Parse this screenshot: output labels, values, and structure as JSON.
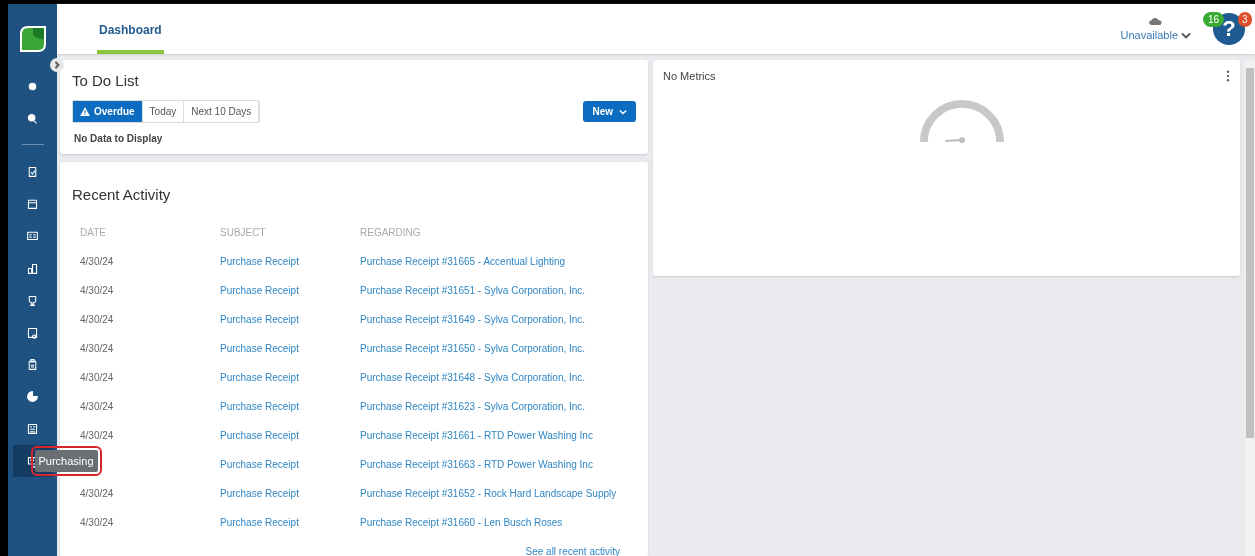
{
  "header": {
    "tabs": [
      {
        "label": "Dashboard",
        "selected": true
      }
    ],
    "status": {
      "label": "Unavailable"
    },
    "help": {
      "label": "?",
      "badges": [
        {
          "count": "16",
          "color": "#3aaa35"
        },
        {
          "count": "3",
          "color": "#e04e2b"
        }
      ]
    }
  },
  "sidebar": {
    "items": [
      {
        "hovered": false
      },
      {
        "hovered": false
      },
      {
        "hovered": false
      },
      {
        "hovered": false
      },
      {
        "hovered": false
      },
      {
        "hovered": false
      },
      {
        "hovered": false
      },
      {
        "hovered": false
      },
      {
        "hovered": false
      },
      {
        "hovered": false
      },
      {
        "hovered": false
      },
      {
        "hovered": true
      }
    ],
    "tooltip": "Purchasing"
  },
  "todo": {
    "title": "To Do List",
    "filters": [
      {
        "label": "Overdue",
        "selected": true
      },
      {
        "label": "Today",
        "selected": false
      },
      {
        "label": "Next 10 Days",
        "selected": false
      }
    ],
    "new_button": "New",
    "empty": "No Data to Display"
  },
  "recent": {
    "title": "Recent Activity",
    "columns": [
      "DATE",
      "SUBJECT",
      "REGARDING"
    ],
    "rows": [
      {
        "date": "4/30/24",
        "subject": "Purchase Receipt",
        "regarding": "Purchase Receipt #31665 - Accentual Lighting"
      },
      {
        "date": "4/30/24",
        "subject": "Purchase Receipt",
        "regarding": "Purchase Receipt #31651 - Sylva Corporation, Inc."
      },
      {
        "date": "4/30/24",
        "subject": "Purchase Receipt",
        "regarding": "Purchase Receipt #31649 - Sylva Corporation, Inc."
      },
      {
        "date": "4/30/24",
        "subject": "Purchase Receipt",
        "regarding": "Purchase Receipt #31650 - Sylva Corporation, Inc."
      },
      {
        "date": "4/30/24",
        "subject": "Purchase Receipt",
        "regarding": "Purchase Receipt #31648 - Sylva Corporation, Inc."
      },
      {
        "date": "4/30/24",
        "subject": "Purchase Receipt",
        "regarding": "Purchase Receipt #31623 - Sylva Corporation, Inc."
      },
      {
        "date": "4/30/24",
        "subject": "Purchase Receipt",
        "regarding": "Purchase Receipt #31661 - RTD Power Washing Inc"
      },
      {
        "subject": "Purchase Receipt",
        "regarding": "Purchase Receipt #31663 - RTD Power Washing Inc"
      },
      {
        "date": "4/30/24",
        "subject": "Purchase Receipt",
        "regarding": "Purchase Receipt #31652 - Rock Hard Landscape Supply"
      },
      {
        "date": "4/30/24",
        "subject": "Purchase Receipt",
        "regarding": "Purchase Receipt #31660 - Len Busch Roses"
      }
    ],
    "see_all": "See all recent activity"
  },
  "metrics": {
    "title": "No Metrics"
  }
}
